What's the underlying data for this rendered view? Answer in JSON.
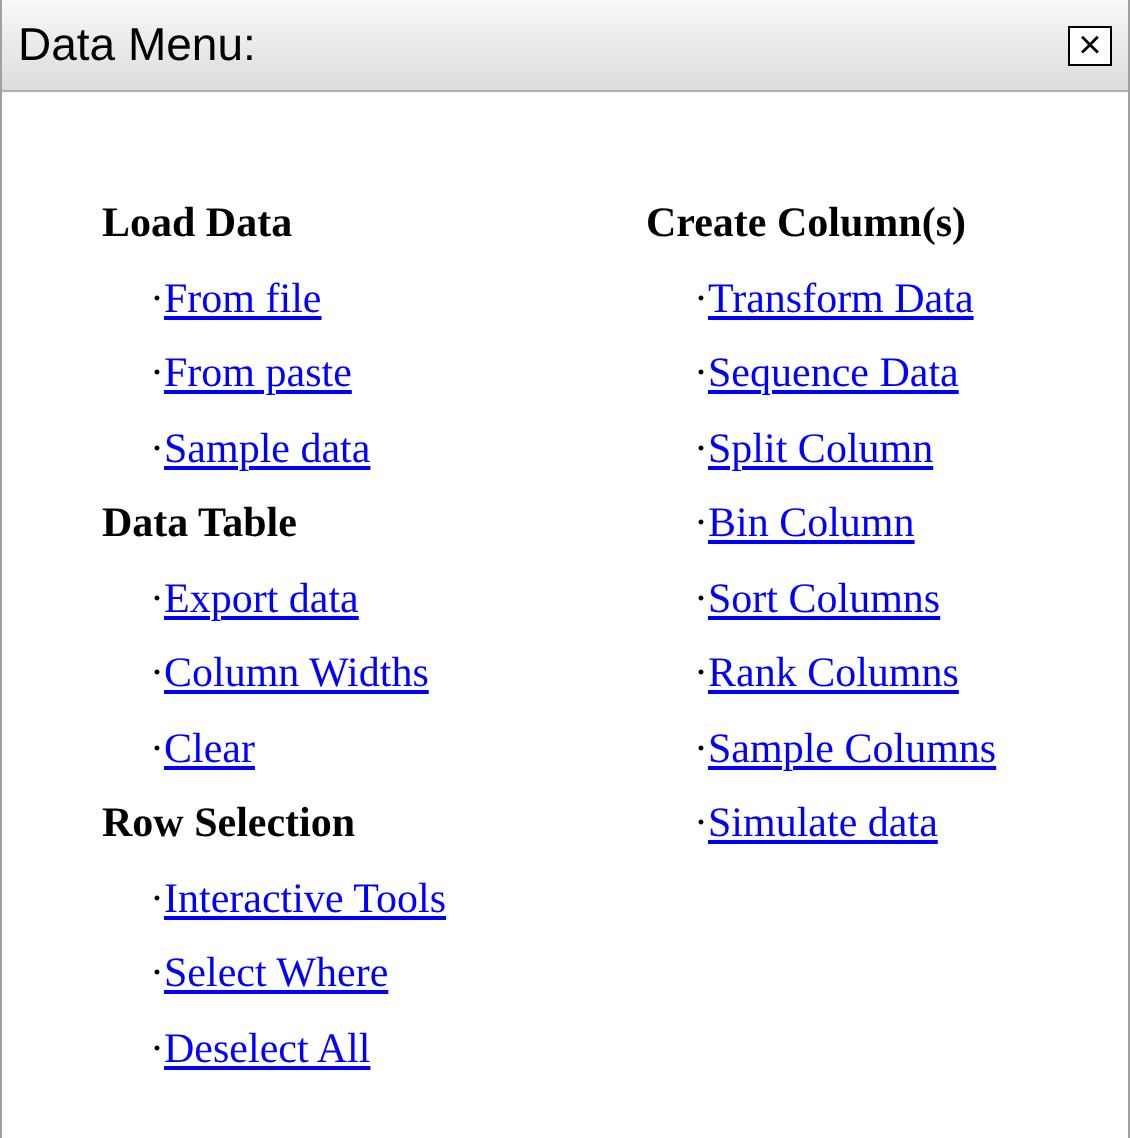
{
  "window": {
    "title": "Data Menu:",
    "close": "×"
  },
  "columns": [
    {
      "sections": [
        {
          "heading": "Load Data",
          "links": [
            {
              "marker": "·",
              "label": "From file"
            },
            {
              "marker": "·",
              "label": "From paste"
            },
            {
              "marker": "·",
              "label": "Sample data"
            }
          ]
        },
        {
          "heading": "Data Table",
          "links": [
            {
              "marker": "·",
              "label": "Export data"
            },
            {
              "marker": "·",
              "label": "Column Widths"
            },
            {
              "marker": "·",
              "label": "Clear"
            }
          ]
        },
        {
          "heading": "Row Selection",
          "links": [
            {
              "marker": "·",
              "label": "Interactive Tools"
            },
            {
              "marker": "·",
              "label": "Select Where"
            },
            {
              "marker": "·",
              "label": "Deselect All"
            }
          ]
        }
      ]
    },
    {
      "sections": [
        {
          "heading": "Create Column(s)",
          "links": [
            {
              "marker": "·",
              "label": "Transform Data"
            },
            {
              "marker": "·",
              "label": "Sequence Data"
            },
            {
              "marker": "·",
              "label": "Split Column"
            },
            {
              "marker": "·",
              "label": "Bin Column"
            },
            {
              "marker": "·",
              "label": "Sort Columns"
            },
            {
              "marker": "·",
              "label": "Rank Columns"
            },
            {
              "marker": "·",
              "label": "Sample Columns"
            },
            {
              "marker": "·",
              "label": "Simulate data"
            }
          ]
        }
      ]
    }
  ]
}
